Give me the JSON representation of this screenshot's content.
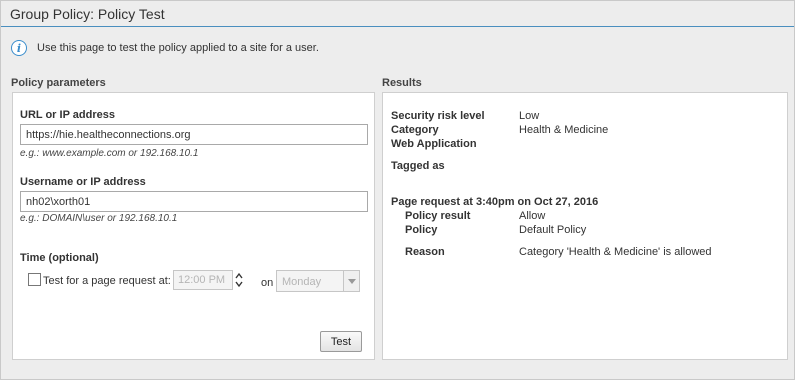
{
  "window": {
    "title": "Group Policy: Policy Test"
  },
  "info": {
    "text": "Use this page to test the policy applied to a site for a user."
  },
  "params": {
    "heading": "Policy parameters",
    "url": {
      "label": "URL or IP address",
      "value": "https://hie.healtheconnections.org",
      "hint": "e.g.: www.example.com or 192.168.10.1"
    },
    "user": {
      "label": "Username or IP address",
      "value": "nh02\\xorth01",
      "hint": "e.g.: DOMAIN\\user or 192.168.10.1"
    },
    "time": {
      "label": "Time (optional)",
      "checkbox_label": "Test for a page request at:",
      "checked": false,
      "time_value": "12:00 PM",
      "on_label": "on",
      "day_value": "Monday"
    },
    "test_button": "Test"
  },
  "results": {
    "heading": "Results",
    "security_risk_label": "Security risk level",
    "security_risk_value": "Low",
    "category_label": "Category",
    "category_value": "Health & Medicine",
    "web_app_label": "Web Application",
    "tagged_label": "Tagged as",
    "page_request": "Page request at 3:40pm on Oct 27, 2016",
    "policy_result_label": "Policy result",
    "policy_result_value": "Allow",
    "policy_label": "Policy",
    "policy_value": "Default Policy",
    "reason_label": "Reason",
    "reason_value": "Category 'Health & Medicine' is allowed"
  },
  "colors": {
    "accent": "#3a8dcc",
    "title_rule": "#4a8fbf"
  }
}
